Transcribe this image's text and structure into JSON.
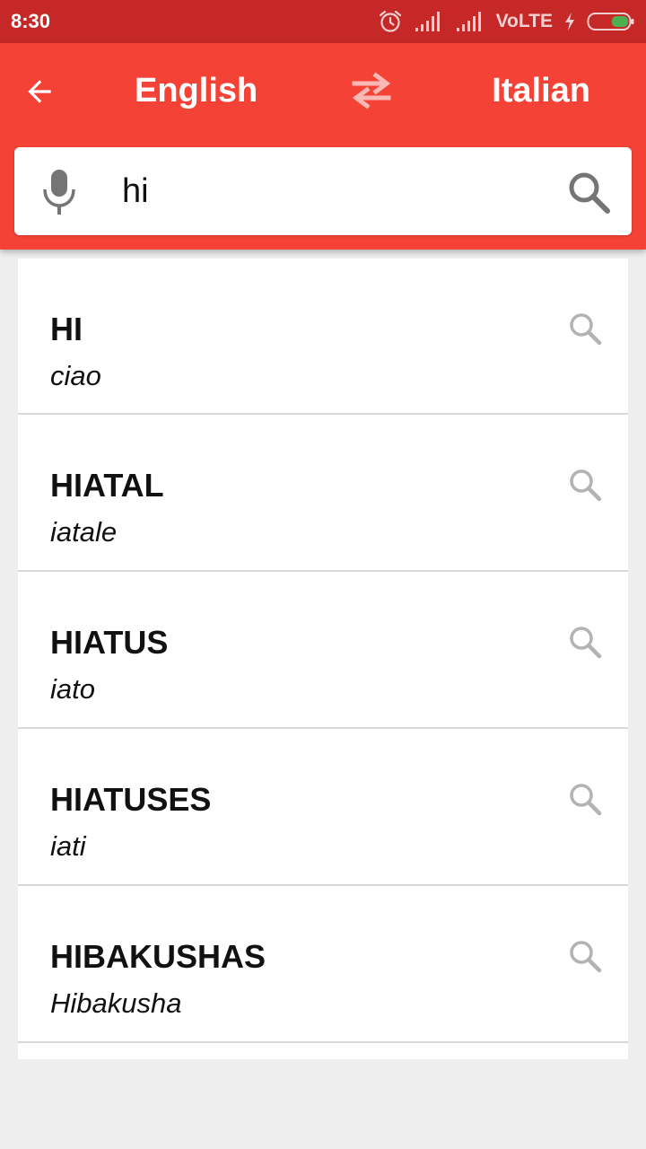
{
  "status_bar": {
    "time": "8:30",
    "network_label": "VoLTE",
    "icons": [
      "alarm-icon",
      "signal-icon",
      "signal-icon",
      "charging-icon",
      "battery-icon"
    ]
  },
  "app_bar": {
    "source_language": "English",
    "target_language": "Italian",
    "icons": [
      "back-arrow-icon",
      "swap-icon"
    ]
  },
  "search": {
    "value": "hi",
    "icons": [
      "microphone-icon",
      "search-icon"
    ]
  },
  "results": [
    {
      "word": "HI",
      "translation": "ciao"
    },
    {
      "word": "HIATAL",
      "translation": "iatale"
    },
    {
      "word": "HIATUS",
      "translation": "iato"
    },
    {
      "word": "HIATUSES",
      "translation": "iati"
    },
    {
      "word": "HIBAKUSHAS",
      "translation": "Hibakusha"
    }
  ],
  "colors": {
    "status_bar": "#c62828",
    "app_bar": "#f44336",
    "background": "#eeeeee"
  }
}
